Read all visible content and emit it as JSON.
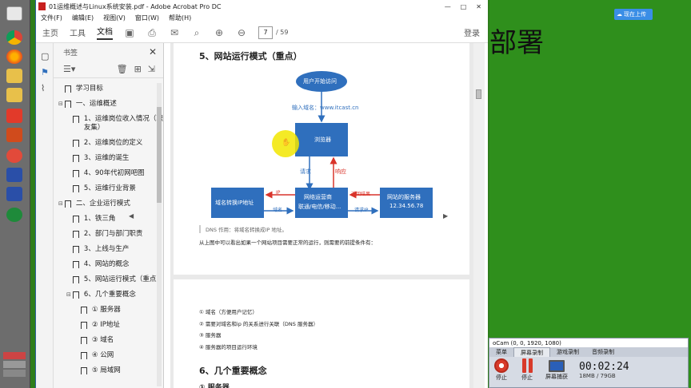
{
  "window": {
    "title": "01运维概述与Linux系统安装.pdf - Adobe Acrobat Pro DC",
    "controls": [
      "—",
      "□",
      "✕"
    ]
  },
  "menu": [
    "文件(F)",
    "编辑(E)",
    "视图(V)",
    "窗口(W)",
    "帮助(H)"
  ],
  "toolbar": {
    "tabs": [
      "主页",
      "工具",
      "文档"
    ],
    "page_current": "7",
    "page_total": "/ 59",
    "login": "登录"
  },
  "bookmarks": {
    "title": "书签",
    "items": [
      {
        "label": "学习目标",
        "level": 0,
        "toggle": ""
      },
      {
        "label": "一、运维概述",
        "level": 0,
        "toggle": "⊟"
      },
      {
        "label": "1、运维岗位收入情况（职友集）",
        "level": 1,
        "toggle": ""
      },
      {
        "label": "2、运维岗位的定义",
        "level": 1,
        "toggle": ""
      },
      {
        "label": "3、运维的诞生",
        "level": 1,
        "toggle": ""
      },
      {
        "label": "4、90年代初网吧图",
        "level": 1,
        "toggle": ""
      },
      {
        "label": "5、运维行业背景",
        "level": 1,
        "toggle": ""
      },
      {
        "label": "二、企业运行模式",
        "level": 0,
        "toggle": "⊟"
      },
      {
        "label": "1、铁三角",
        "level": 1,
        "toggle": ""
      },
      {
        "label": "2、部门与部门职责",
        "level": 1,
        "toggle": ""
      },
      {
        "label": "3、上线与生产",
        "level": 1,
        "toggle": ""
      },
      {
        "label": "4、网站的概念",
        "level": 1,
        "toggle": ""
      },
      {
        "label": "5、网站运行模式（重点）",
        "level": 1,
        "toggle": ""
      },
      {
        "label": "6、几个重要概念",
        "level": 1,
        "toggle": "⊟"
      },
      {
        "label": "① 服务器",
        "level": 2,
        "toggle": ""
      },
      {
        "label": "② IP地址",
        "level": 2,
        "toggle": ""
      },
      {
        "label": "③ 域名",
        "level": 2,
        "toggle": ""
      },
      {
        "label": "④ 公网",
        "level": 2,
        "toggle": ""
      },
      {
        "label": "⑤ 局域网",
        "level": 2,
        "toggle": ""
      }
    ]
  },
  "doc": {
    "heading": "5、网站运行模式（重点）",
    "diagram": {
      "start": "用户开始访问",
      "input_label": "输入域名：www.itcast.cn",
      "browser": "浏览器",
      "request": "请求",
      "response": "响应",
      "dns": "域名转换IP地址",
      "isp_line1": "网络运营商",
      "isp_line2": "联通/电信/移动...",
      "server_line1": "网站的服务器",
      "server_line2": "12.34.56.78",
      "ip_label": "IP",
      "domain_label": "域名",
      "return_label": "返回结果",
      "request_ip": "请求IP"
    },
    "dns_note": "DNS 作用：将域名转换成IP 地址。",
    "summary": "从上图中可以看出如果一个网站项目需要正常的运行，则需要的前提条件有：",
    "conditions": [
      "① 域名（方便用户记忆）",
      "② 需要对域名和ip 的关系进行关联（DNS 服务器）",
      "③ 服务器",
      "④ 服务器的项目运行环境"
    ],
    "heading2": "6、几个重要概念",
    "heading3": "① 服务器"
  },
  "desktop": {
    "big_text": "部署",
    "cloud_button": "现在上传"
  },
  "ocam": {
    "title": "oCam (0, 0, 1920, 1080)",
    "tabs": [
      "菜单",
      "屏幕录制",
      "游戏录制",
      "音频录制"
    ],
    "stop_label": "停止",
    "pause_label": "停止",
    "capture_label": "屏幕捕获",
    "timer": "00:02:24",
    "size": "18MB / 79GB"
  },
  "colors": {
    "diagram_blue": "#2f6fbd",
    "arrow_red": "#d9342b",
    "taskbar": "#6d6d6d",
    "desktop_green": "#2f8f1c"
  }
}
